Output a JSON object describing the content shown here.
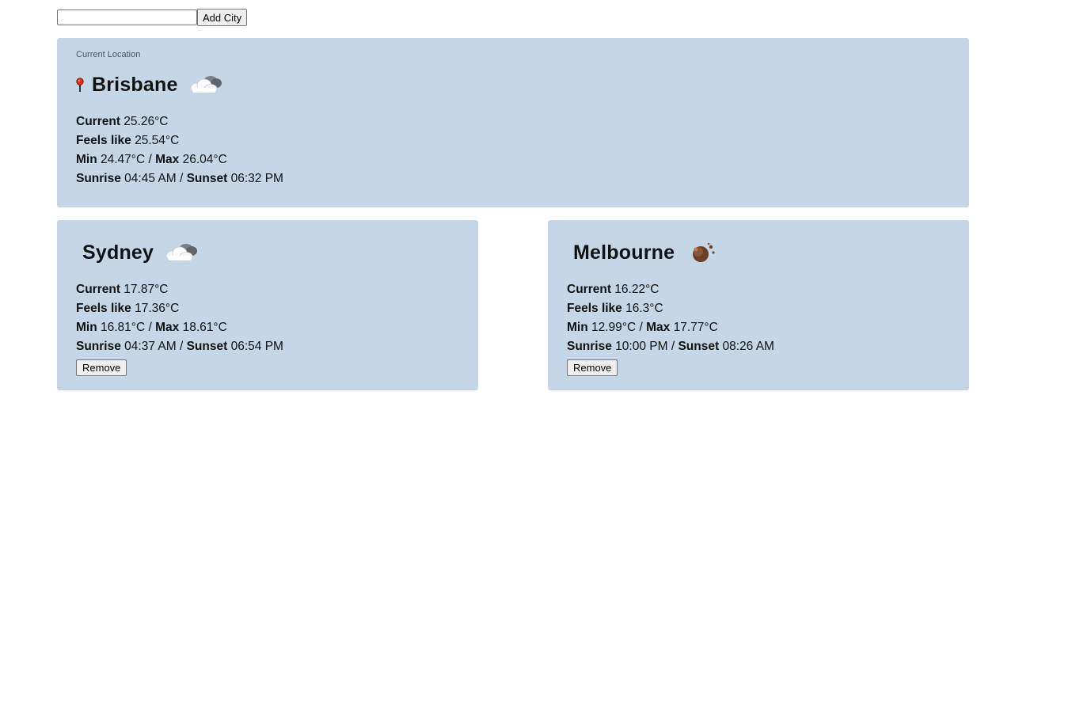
{
  "add_city": {
    "input_value": "",
    "button_label": "Add City"
  },
  "current_location": {
    "label": "Current Location",
    "city": "Brisbane",
    "icon": "partly-cloudy-icon",
    "current_label": "Current",
    "current_value": "25.26°C",
    "feels_label": "Feels like",
    "feels_value": "25.54°C",
    "min_label": "Min",
    "min_value": "24.47°C",
    "max_label": "Max",
    "max_value": "26.04°C",
    "sunrise_label": "Sunrise",
    "sunrise_value": "04:45 AM",
    "sunset_label": "Sunset",
    "sunset_value": "06:32 PM"
  },
  "cities": [
    {
      "city": "Sydney",
      "icon": "partly-cloudy-icon",
      "current_label": "Current",
      "current_value": "17.87°C",
      "feels_label": "Feels like",
      "feels_value": "17.36°C",
      "min_label": "Min",
      "min_value": "16.81°C",
      "max_label": "Max",
      "max_value": "18.61°C",
      "sunrise_label": "Sunrise",
      "sunrise_value": "04:37 AM",
      "sunset_label": "Sunset",
      "sunset_value": "06:54 PM",
      "remove_label": "Remove"
    },
    {
      "city": "Melbourne",
      "icon": "dust-icon",
      "current_label": "Current",
      "current_value": "16.22°C",
      "feels_label": "Feels like",
      "feels_value": "16.3°C",
      "min_label": "Min",
      "min_value": "12.99°C",
      "max_label": "Max",
      "max_value": "17.77°C",
      "sunrise_label": "Sunrise",
      "sunrise_value": "10:00 PM",
      "sunset_label": "Sunset",
      "sunset_value": "08:26 AM",
      "remove_label": "Remove"
    }
  ],
  "colors": {
    "card_background": "#c5d6e6",
    "page_background": "#ffffff"
  }
}
